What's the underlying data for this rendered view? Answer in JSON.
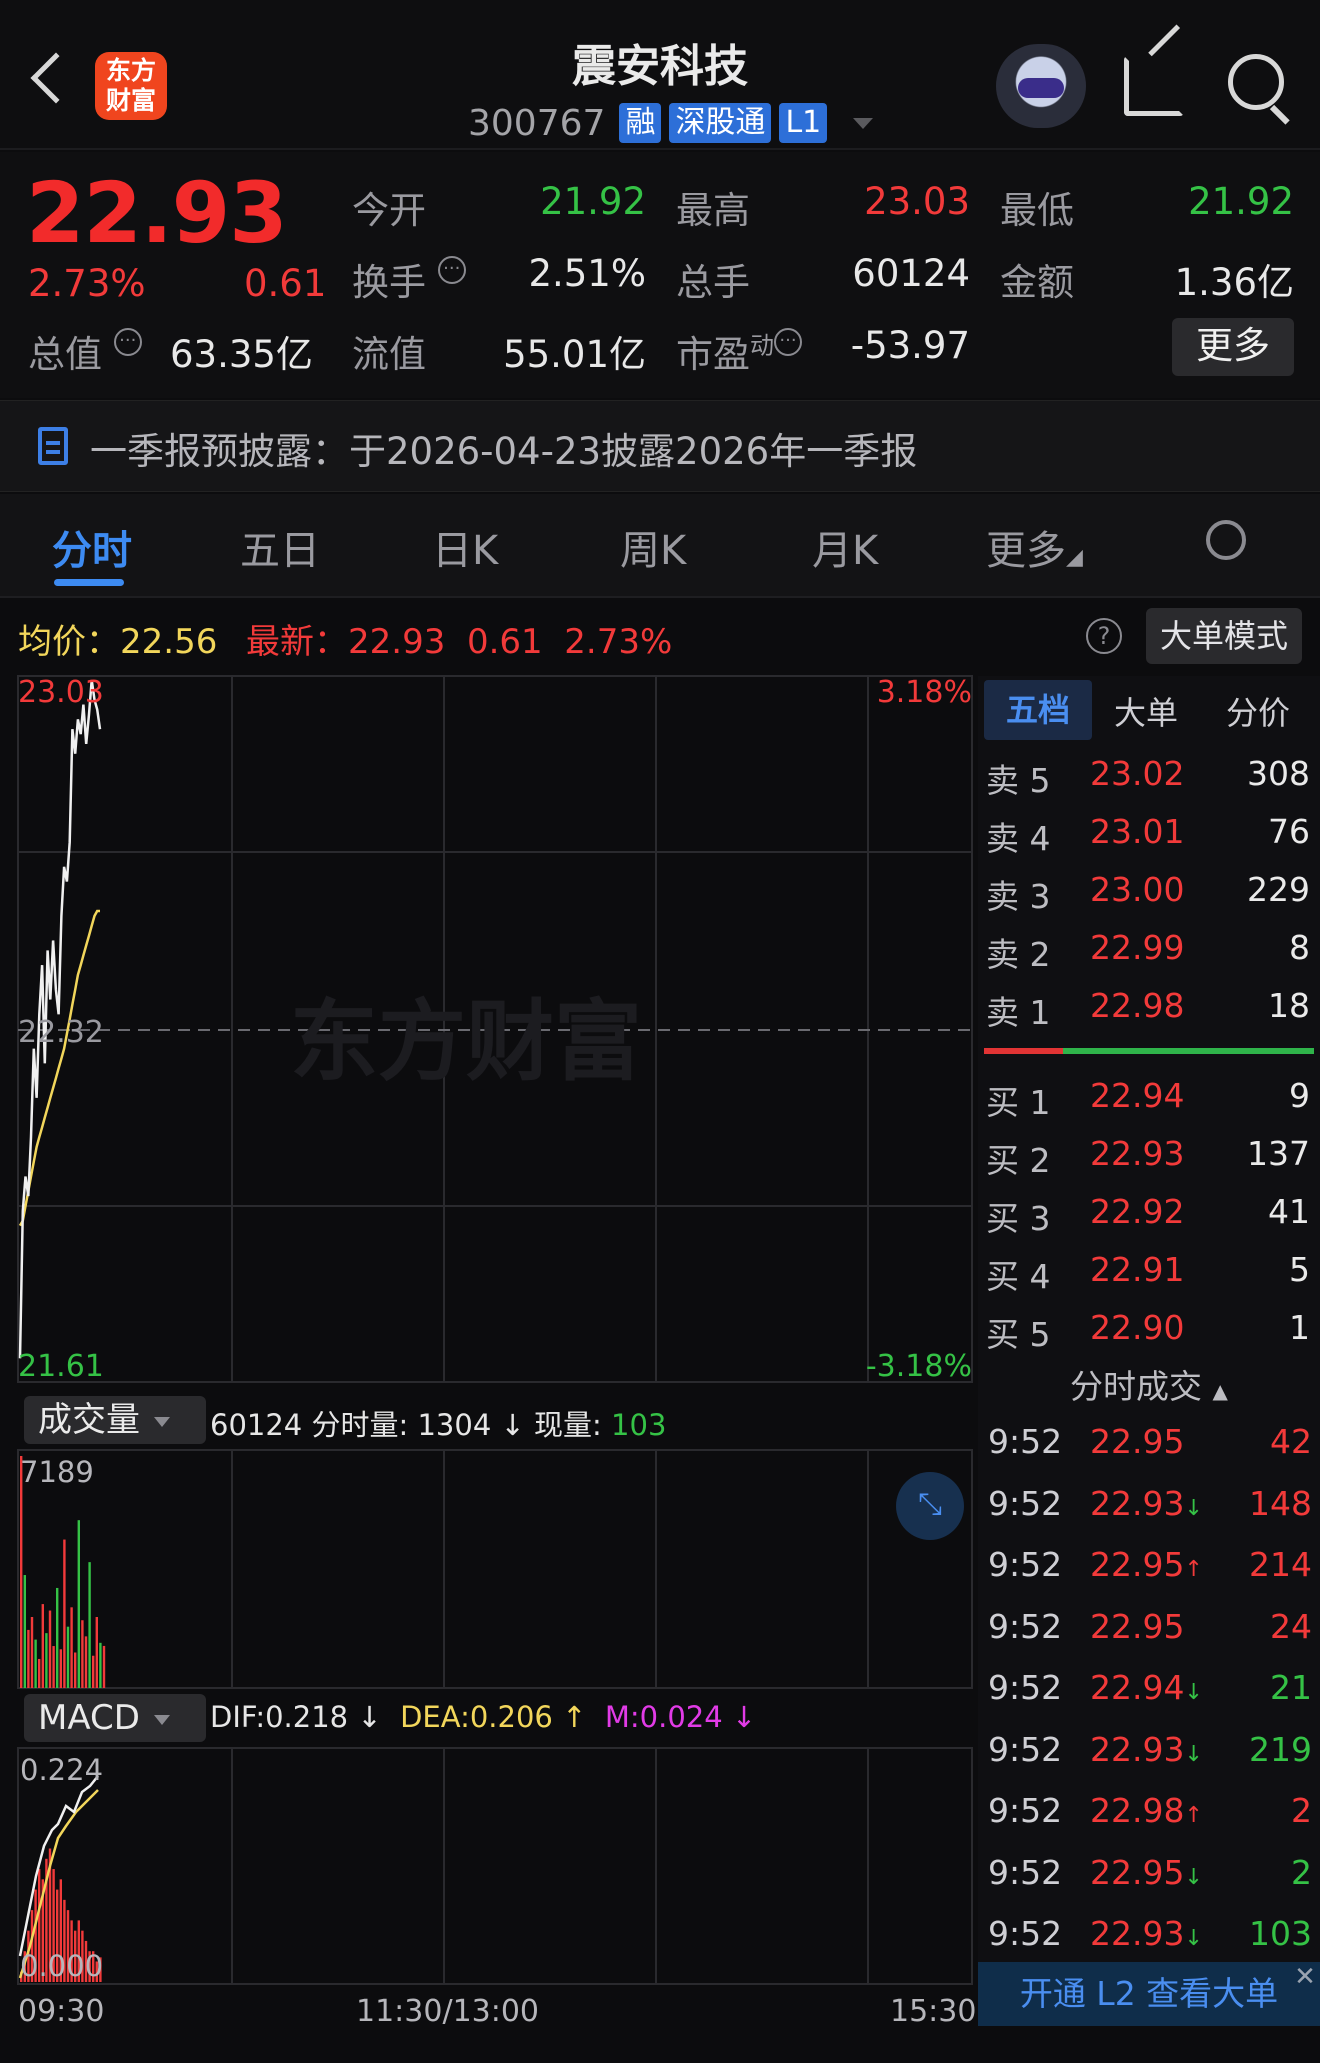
{
  "header": {
    "title": "震安科技",
    "code": "300767",
    "tags": [
      "融",
      "深股通",
      "L1"
    ],
    "logo_line1": "东方",
    "logo_line2": "财富"
  },
  "quote": {
    "price": "22.93",
    "change_pct": "2.73%",
    "change": "0.61",
    "open_label": "今开",
    "open": "21.92",
    "high_label": "最高",
    "high": "23.03",
    "low_label": "最低",
    "low": "21.92",
    "turnover_label": "换手",
    "turnover": "2.51%",
    "volume_label": "总手",
    "volume": "60124",
    "amount_label": "金额",
    "amount": "1.36亿",
    "mktcap_label": "总值",
    "mktcap": "63.35亿",
    "float_label": "流值",
    "float": "55.01亿",
    "pe_label": "市盈",
    "pe_sup": "动",
    "pe": "-53.97",
    "more": "更多"
  },
  "notice": "一季报预披露：于2026-04-23披露2026年一季报",
  "tabs": [
    "分时",
    "五日",
    "日K",
    "周K",
    "月K",
    "更多"
  ],
  "chart_head": {
    "avg_label": "均价：",
    "avg": "22.56",
    "latest_label": "最新：",
    "latest": "22.93",
    "chg": "0.61",
    "pct": "2.73%",
    "help": "?",
    "mode_button": "大单模式"
  },
  "chart_data": {
    "type": "line",
    "ylim": [
      21.61,
      23.03
    ],
    "y_labels": {
      "top": "23.03",
      "mid": "22.32",
      "bottom": "21.61"
    },
    "pct_labels": {
      "top": "3.18%",
      "bottom": "-3.18%"
    },
    "watermark": "东方财富",
    "x_labels": [
      "09:30",
      "11:30/13:00",
      "15:30"
    ],
    "price_series": [
      21.65,
      21.95,
      22.02,
      21.98,
      22.1,
      22.28,
      22.18,
      22.35,
      22.45,
      22.25,
      22.48,
      22.38,
      22.5,
      22.4,
      22.35,
      22.55,
      22.65,
      22.62,
      22.7,
      22.93,
      22.88,
      22.95,
      22.92,
      22.98,
      22.9,
      22.96,
      23.03,
      22.99,
      22.97,
      22.93
    ],
    "avg_series": [
      21.92,
      21.93,
      21.96,
      21.99,
      22.02,
      22.05,
      22.08,
      22.1,
      22.12,
      22.14,
      22.16,
      22.18,
      22.2,
      22.22,
      22.24,
      22.26,
      22.28,
      22.31,
      22.34,
      22.37,
      22.4,
      22.43,
      22.45,
      22.47,
      22.49,
      22.51,
      22.53,
      22.55,
      22.56,
      22.56
    ]
  },
  "book": {
    "tabs": [
      "五档",
      "大单",
      "分价"
    ],
    "sell": [
      {
        "name": "卖 5",
        "price": "23.02",
        "vol": "308"
      },
      {
        "name": "卖 4",
        "price": "23.01",
        "vol": "76"
      },
      {
        "name": "卖 3",
        "price": "23.00",
        "vol": "229"
      },
      {
        "name": "卖 2",
        "price": "22.99",
        "vol": "8"
      },
      {
        "name": "卖 1",
        "price": "22.98",
        "vol": "18"
      }
    ],
    "buy": [
      {
        "name": "买 1",
        "price": "22.94",
        "vol": "9"
      },
      {
        "name": "买 2",
        "price": "22.93",
        "vol": "137"
      },
      {
        "name": "买 3",
        "price": "22.92",
        "vol": "41"
      },
      {
        "name": "买 4",
        "price": "22.91",
        "vol": "5"
      },
      {
        "name": "买 5",
        "price": "22.90",
        "vol": "1"
      }
    ],
    "trades_title": "分时成交",
    "trades": [
      {
        "time": "9:52",
        "price": "22.95",
        "arrow": "",
        "vol": "42",
        "dir": "red"
      },
      {
        "time": "9:52",
        "price": "22.93",
        "arrow": "↓",
        "vol": "148",
        "dir": "red"
      },
      {
        "time": "9:52",
        "price": "22.95",
        "arrow": "↑",
        "vol": "214",
        "dir": "red"
      },
      {
        "time": "9:52",
        "price": "22.95",
        "arrow": "",
        "vol": "24",
        "dir": "red"
      },
      {
        "time": "9:52",
        "price": "22.94",
        "arrow": "↓",
        "vol": "21",
        "dir": "green"
      },
      {
        "time": "9:52",
        "price": "22.93",
        "arrow": "↓",
        "vol": "219",
        "dir": "green"
      },
      {
        "time": "9:52",
        "price": "22.98",
        "arrow": "↑",
        "vol": "2",
        "dir": "red"
      },
      {
        "time": "9:52",
        "price": "22.95",
        "arrow": "↓",
        "vol": "2",
        "dir": "green"
      },
      {
        "time": "9:52",
        "price": "22.93",
        "arrow": "↓",
        "vol": "103",
        "dir": "green"
      }
    ],
    "l2_button": "开通 L2 查看大单"
  },
  "volume_panel": {
    "label": "成交量",
    "total": "60124",
    "minute_label": "分时量:",
    "minute": "1304",
    "now_label": "现量:",
    "now": "103",
    "max": "7189",
    "bars": [
      7189,
      3500,
      1800,
      2200,
      1500,
      900,
      2600,
      1700,
      2400,
      1300,
      3100,
      1200,
      4600,
      1900,
      2500,
      1100,
      5200,
      2100,
      1600,
      3900,
      1000,
      2200,
      1400,
      1304
    ]
  },
  "macd_panel": {
    "label": "MACD",
    "dif_label": "DIF:",
    "dif": "0.218",
    "dea_label": "DEA:",
    "dea": "0.206",
    "m_label": "M:",
    "m": "0.024",
    "top": "0.224",
    "bottom": "0.000",
    "bars": [
      0.01,
      0.03,
      0.05,
      0.07,
      0.09,
      0.11,
      0.1,
      0.12,
      0.13,
      0.11,
      0.09,
      0.1,
      0.08,
      0.07,
      0.06,
      0.05,
      0.06,
      0.05,
      0.04,
      0.03,
      0.03,
      0.02,
      0.024
    ]
  },
  "colors": {
    "up": "#f23a3a",
    "down": "#35c246",
    "accent": "#3d8bf2",
    "avg_line": "#f2d65b"
  }
}
